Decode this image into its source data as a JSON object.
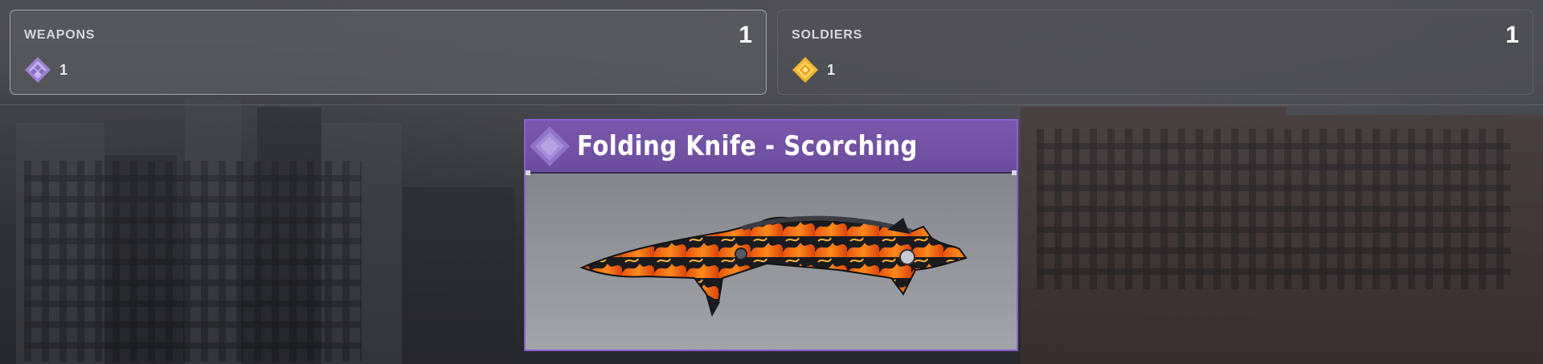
{
  "panels": [
    {
      "title": "WEAPONS",
      "count": "1",
      "rarity_icon": "purple-diamond-icon",
      "rarity_value": "1",
      "color": "#a78ad8"
    },
    {
      "title": "SOLDIERS",
      "count": "1",
      "rarity_icon": "gold-diamond-icon",
      "rarity_value": "1",
      "color": "#f2b42e"
    }
  ],
  "card": {
    "title": "Folding Knife - Scorching",
    "rarity_icon": "purple-diamond-icon",
    "border_color": "#8b5fd0",
    "header_color": "#6f50a3",
    "image": "folding-knife-scorching-skin"
  }
}
